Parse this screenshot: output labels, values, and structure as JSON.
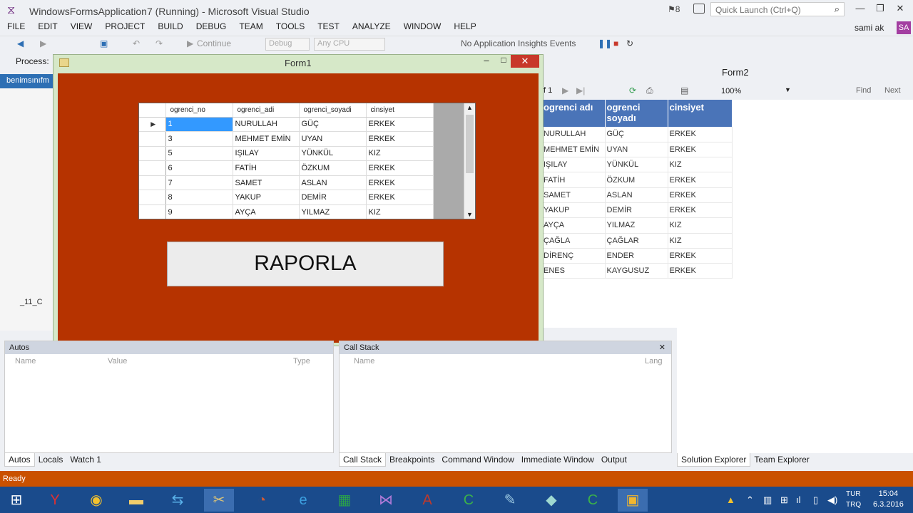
{
  "window": {
    "title": "WindowsFormsApplication7 (Running) - Microsoft Visual Studio",
    "notif_count": "8",
    "quick_launch_placeholder": "Quick Launch (Ctrl+Q)"
  },
  "menu": [
    "FILE",
    "EDIT",
    "VIEW",
    "PROJECT",
    "BUILD",
    "DEBUG",
    "TEAM",
    "TOOLS",
    "TEST",
    "ANALYZE",
    "WINDOW",
    "HELP"
  ],
  "user": {
    "name": "sami ak",
    "initials": "SA"
  },
  "toolbar": {
    "continue_label": "Continue",
    "config": "Debug",
    "platform": "Any CPU",
    "insights": "No Application Insights Events"
  },
  "process": {
    "label": "Process:"
  },
  "left_panel": {
    "tab": "benimsınıfm",
    "item": "_11_C"
  },
  "form1": {
    "caption": "Form1",
    "grid_columns": [
      "ogrenci_no",
      "ogrenci_adi",
      "ogrenci_soyadi",
      "cinsiyet"
    ],
    "grid_rows": [
      [
        "1",
        "NURULLAH",
        "GÜÇ",
        "ERKEK"
      ],
      [
        "3",
        "MEHMET EMİN",
        "UYAN",
        "ERKEK"
      ],
      [
        "5",
        "IŞILAY",
        "YÜNKÜL",
        "KIZ"
      ],
      [
        "6",
        "FATİH",
        "ÖZKUM",
        "ERKEK"
      ],
      [
        "7",
        "SAMET",
        "ASLAN",
        "ERKEK"
      ],
      [
        "8",
        "YAKUP",
        "DEMİR",
        "ERKEK"
      ],
      [
        "9",
        "AYÇA",
        "YILMAZ",
        "KIZ"
      ]
    ],
    "button_label": "RAPORLA"
  },
  "form2": {
    "caption": "Form2",
    "page_of": "f 1",
    "zoom": "100%",
    "find": "Find",
    "next": "Next",
    "report_columns": [
      "ogrenci adı",
      "ogrenci soyadı",
      "cinsiyet"
    ],
    "report_rows": [
      [
        "NURULLAH",
        "GÜÇ",
        "ERKEK"
      ],
      [
        "MEHMET EMİN",
        "UYAN",
        "ERKEK"
      ],
      [
        "IŞILAY",
        "YÜNKÜL",
        "KIZ"
      ],
      [
        "FATİH",
        "ÖZKUM",
        "ERKEK"
      ],
      [
        "SAMET",
        "ASLAN",
        "ERKEK"
      ],
      [
        "YAKUP",
        "DEMİR",
        "ERKEK"
      ],
      [
        "AYÇA",
        "YILMAZ",
        "KIZ"
      ],
      [
        "ÇAĞLA",
        "ÇAĞLAR",
        "KIZ"
      ],
      [
        "DİRENÇ",
        "ENDER",
        "ERKEK"
      ],
      [
        "ENES",
        "KAYGUSUZ",
        "ERKEK"
      ]
    ]
  },
  "autos": {
    "title": "Autos",
    "col_name": "Name",
    "col_value": "Value",
    "col_type": "Type"
  },
  "callstack": {
    "title": "Call Stack",
    "col_name": "Name",
    "col_lang": "Lang"
  },
  "bottom_tabs_left": [
    "Autos",
    "Locals",
    "Watch 1"
  ],
  "bottom_tabs_mid": [
    "Call Stack",
    "Breakpoints",
    "Command Window",
    "Immediate Window",
    "Output"
  ],
  "bottom_tabs_right": [
    "Solution Explorer",
    "Team Explorer"
  ],
  "status": "Ready",
  "tray": {
    "lang1": "TUR",
    "lang2": "TRQ",
    "time": "15:04",
    "date": "6.3.2016"
  },
  "taskbar_apps": [
    "windows-start",
    "yandex-browser",
    "chrome",
    "file-explorer",
    "teamviewer",
    "tools",
    "circle-app",
    "internet-explorer",
    "excel-app",
    "visual-studio",
    "access-app",
    "camtasia",
    "paint-app",
    "notepad-app",
    "camtasia-recorder",
    "running-form"
  ]
}
